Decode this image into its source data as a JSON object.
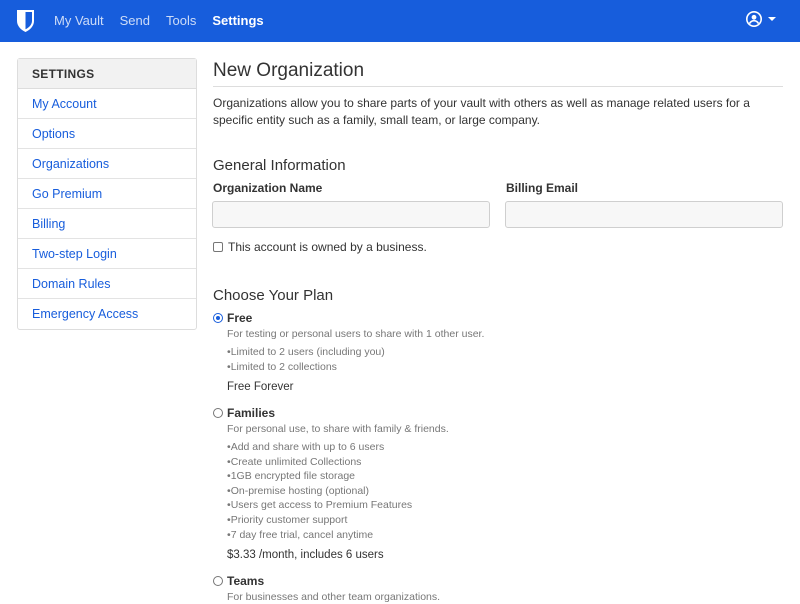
{
  "nav": {
    "links": [
      "My Vault",
      "Send",
      "Tools",
      "Settings"
    ],
    "active": "Settings"
  },
  "sidebar": {
    "header": "SETTINGS",
    "items": [
      "My Account",
      "Options",
      "Organizations",
      "Go Premium",
      "Billing",
      "Two-step Login",
      "Domain Rules",
      "Emergency Access"
    ]
  },
  "main": {
    "title": "New Organization",
    "intro": "Organizations allow you to share parts of your vault with others as well as manage related users for a specific entity such as a family, small team, or large company.",
    "general_title": "General Information",
    "org_name_label": "Organization Name",
    "org_name_value": "",
    "billing_email_label": "Billing Email",
    "billing_email_value": "",
    "business_checkbox_label": "This account is owned by a business.",
    "business_checked": false,
    "plan_title": "Choose Your Plan",
    "plans": [
      {
        "name": "Free",
        "checked": true,
        "description": "For testing or personal users to share with 1 other user.",
        "features": [
          "Limited to 2 users (including you)",
          "Limited to 2 collections"
        ],
        "price": "Free Forever"
      },
      {
        "name": "Families",
        "checked": false,
        "description": "For personal use, to share with family & friends.",
        "features": [
          "Add and share with up to 6 users",
          "Create unlimited Collections",
          "1GB encrypted file storage",
          "On-premise hosting (optional)",
          "Users get access to Premium Features",
          "Priority customer support",
          "7 day free trial, cancel anytime"
        ],
        "price": "$3.33 /month, includes 6 users"
      },
      {
        "name": "Teams",
        "checked": false,
        "description": "For businesses and other team organizations."
      }
    ]
  },
  "colors": {
    "brand": "#175ddc",
    "link": "#175ddc",
    "muted_text": "#777777"
  },
  "icons": {
    "brand": "shield-logo-icon",
    "account": "user-circle-icon",
    "caret": "caret-down-icon"
  }
}
